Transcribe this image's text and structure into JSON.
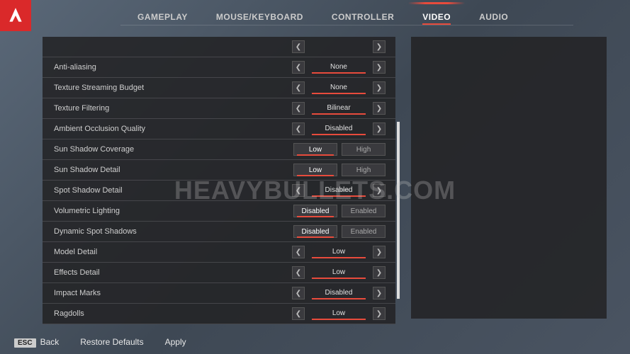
{
  "tabs": [
    "GAMEPLAY",
    "MOUSE/KEYBOARD",
    "CONTROLLER",
    "VIDEO",
    "AUDIO"
  ],
  "activeTab": 3,
  "settings": [
    {
      "label": "",
      "type": "selector",
      "value": ""
    },
    {
      "label": "Anti-aliasing",
      "type": "selector",
      "value": "None"
    },
    {
      "label": "Texture Streaming Budget",
      "type": "selector",
      "value": "None"
    },
    {
      "label": "Texture Filtering",
      "type": "selector",
      "value": "Bilinear"
    },
    {
      "label": "Ambient Occlusion Quality",
      "type": "selector",
      "value": "Disabled"
    },
    {
      "label": "Sun Shadow Coverage",
      "type": "toggle",
      "options": [
        "Low",
        "High"
      ],
      "selected": 0
    },
    {
      "label": "Sun Shadow Detail",
      "type": "toggle",
      "options": [
        "Low",
        "High"
      ],
      "selected": 0
    },
    {
      "label": "Spot Shadow Detail",
      "type": "selector",
      "value": "Disabled"
    },
    {
      "label": "Volumetric Lighting",
      "type": "toggle",
      "options": [
        "Disabled",
        "Enabled"
      ],
      "selected": 0
    },
    {
      "label": "Dynamic Spot Shadows",
      "type": "toggle",
      "options": [
        "Disabled",
        "Enabled"
      ],
      "selected": 0
    },
    {
      "label": "Model Detail",
      "type": "selector",
      "value": "Low"
    },
    {
      "label": "Effects Detail",
      "type": "selector",
      "value": "Low"
    },
    {
      "label": "Impact Marks",
      "type": "selector",
      "value": "Disabled"
    },
    {
      "label": "Ragdolls",
      "type": "selector",
      "value": "Low"
    }
  ],
  "footer": {
    "escKey": "ESC",
    "back": "Back",
    "restore": "Restore Defaults",
    "apply": "Apply"
  },
  "watermark": "HEAVYBULLETS.COM"
}
